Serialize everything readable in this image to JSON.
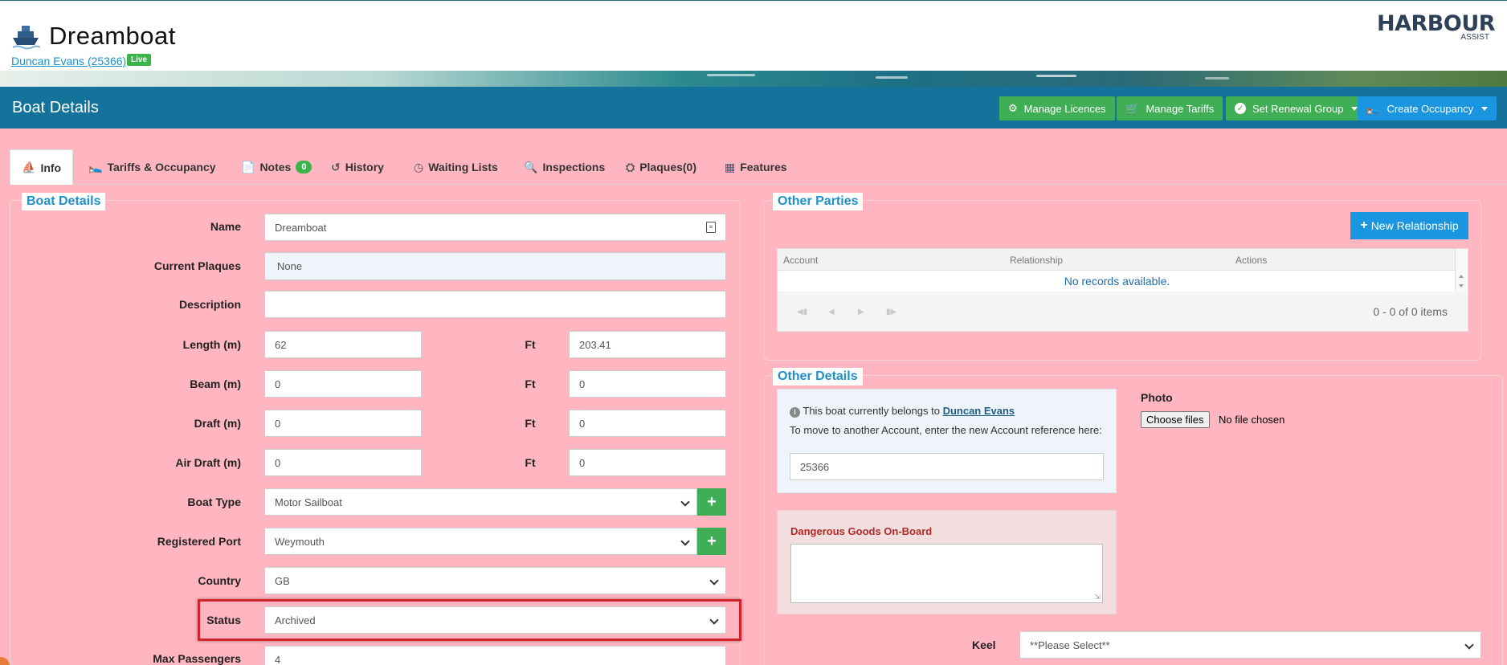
{
  "header": {
    "boat_name": "Dreamboat",
    "owner_link": "Duncan Evans (25366)",
    "status_badge": "Live",
    "logo_main": "HARBOUR",
    "logo_sub": "ASSIST"
  },
  "toolbar": {
    "page_title": "Boat Details",
    "manage_licences": "Manage Licences",
    "manage_tariffs": "Manage Tariffs",
    "set_renewal_group": "Set Renewal Group",
    "create_occupancy": "Create Occupancy"
  },
  "tabs": {
    "info": "Info",
    "tariffs": "Tariffs & Occupancy",
    "notes": "Notes",
    "notes_count": "0",
    "history": "History",
    "waiting_lists": "Waiting Lists",
    "inspections": "Inspections",
    "plaques": "Plaques(0)",
    "features": "Features"
  },
  "boat_details": {
    "legend": "Boat Details",
    "name_label": "Name",
    "name_value": "Dreamboat",
    "plaques_label": "Current Plaques",
    "plaques_value": "None",
    "description_label": "Description",
    "description_value": "",
    "length_label": "Length (m)",
    "length_m": "62",
    "length_ft": "203.41",
    "beam_label": "Beam (m)",
    "beam_m": "0",
    "beam_ft": "0",
    "draft_label": "Draft (m)",
    "draft_m": "0",
    "draft_ft": "0",
    "air_draft_label": "Air Draft (m)",
    "air_draft_m": "0",
    "air_draft_ft": "0",
    "ft_label": "Ft",
    "boat_type_label": "Boat Type",
    "boat_type_value": "Motor Sailboat",
    "port_label": "Registered Port",
    "port_value": "Weymouth",
    "country_label": "Country",
    "country_value": "GB",
    "status_label": "Status",
    "status_value": "Archived",
    "max_passengers_label": "Max Passengers",
    "max_passengers_value": "4",
    "plus": "+"
  },
  "other_parties": {
    "legend": "Other Parties",
    "new_relationship": "New Relationship",
    "col_account": "Account",
    "col_relationship": "Relationship",
    "col_actions": "Actions",
    "empty": "No records available.",
    "pager_info": "0 - 0 of 0 items"
  },
  "other_details": {
    "legend": "Other Details",
    "belongs_text": "This boat currently belongs to",
    "belongs_owner": "Duncan Evans",
    "move_text": "To move to another Account, enter the new Account reference here:",
    "account_ref": "25366",
    "photo_label": "Photo",
    "choose_files": "Choose files",
    "no_file": "No file chosen",
    "dangerous_goods_label": "Dangerous Goods On-Board",
    "keel_label": "Keel",
    "keel_value": "**Please Select**"
  }
}
